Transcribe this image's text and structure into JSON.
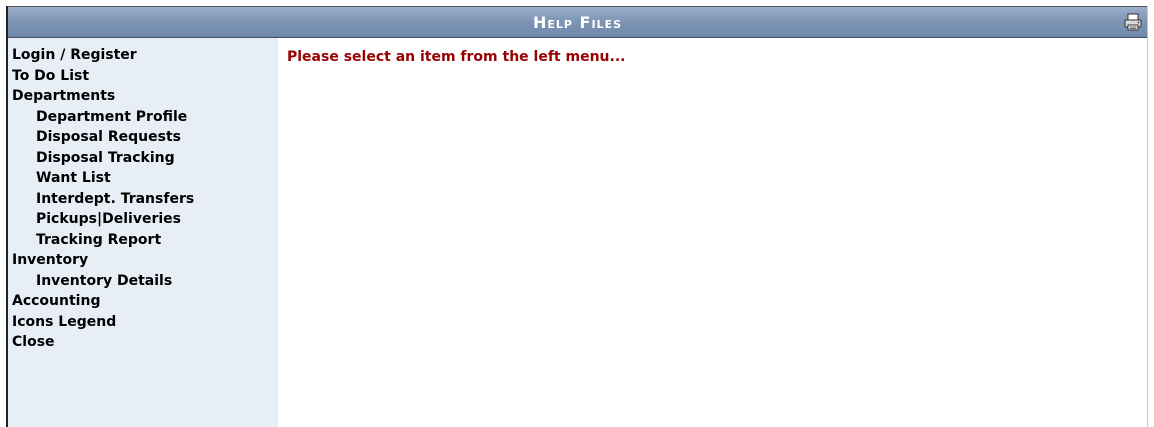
{
  "window": {
    "title": "Help Files",
    "print_icon": "printer-icon"
  },
  "sidebar": {
    "items": [
      {
        "label": "Login / Register",
        "level": 0
      },
      {
        "label": "To Do List",
        "level": 0
      },
      {
        "label": "Departments",
        "level": 0
      },
      {
        "label": "Department Profile",
        "level": 1
      },
      {
        "label": "Disposal Requests",
        "level": 1
      },
      {
        "label": "Disposal Tracking",
        "level": 1
      },
      {
        "label": "Want List",
        "level": 1
      },
      {
        "label": "Interdept. Transfers",
        "level": 1
      },
      {
        "label": "Pickups|Deliveries",
        "level": 1
      },
      {
        "label": "Tracking Report",
        "level": 1
      },
      {
        "label": "Inventory",
        "level": 0
      },
      {
        "label": "Inventory Details",
        "level": 1
      },
      {
        "label": "Accounting",
        "level": 0
      },
      {
        "label": "Icons Legend",
        "level": 0
      },
      {
        "label": "Close",
        "level": 0
      }
    ]
  },
  "main": {
    "message": "Please select an item from the left menu..."
  },
  "colors": {
    "titlebar": "#7f96b6",
    "sidebar_bg": "#e8eef6",
    "message": "#990000"
  }
}
